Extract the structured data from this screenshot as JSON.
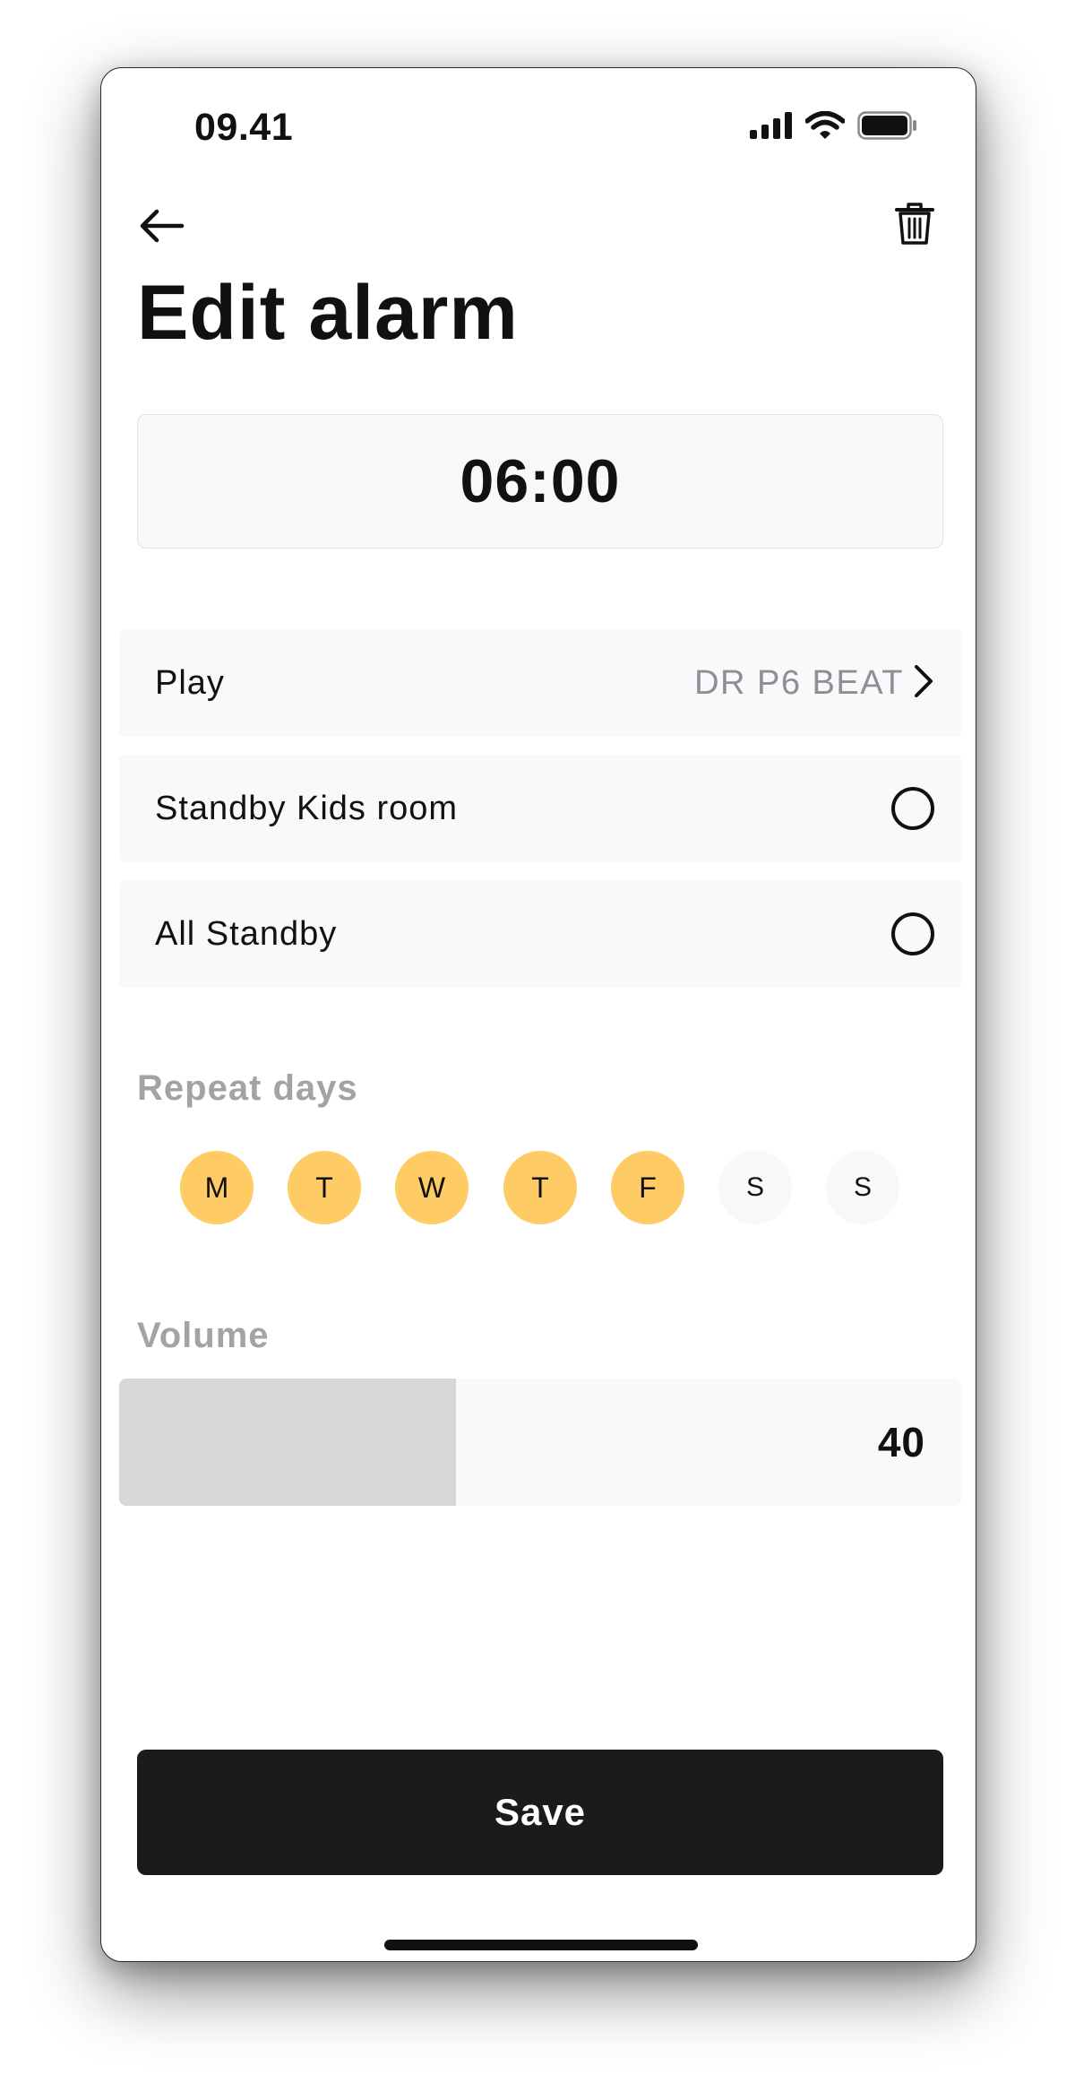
{
  "status_bar": {
    "time": "09.41",
    "icons": [
      "cellular-signal-icon",
      "wifi-icon",
      "battery-icon"
    ]
  },
  "header": {
    "back_icon": "arrow-left-icon",
    "delete_icon": "trash-icon",
    "title": "Edit alarm"
  },
  "alarm": {
    "time": "06:00"
  },
  "rows": {
    "play": {
      "label": "Play",
      "value": "DR P6 BEAT",
      "icon": "chevron-right-icon"
    },
    "standby_kids": {
      "label": "Standby Kids room",
      "selected": false
    },
    "all_standby": {
      "label": "All Standby",
      "selected": false
    }
  },
  "repeat": {
    "label": "Repeat days",
    "days": [
      {
        "letter": "M",
        "active": true
      },
      {
        "letter": "T",
        "active": true
      },
      {
        "letter": "W",
        "active": true
      },
      {
        "letter": "T",
        "active": true
      },
      {
        "letter": "F",
        "active": true
      },
      {
        "letter": "S",
        "active": false
      },
      {
        "letter": "S",
        "active": false
      }
    ]
  },
  "volume": {
    "label": "Volume",
    "value": "40",
    "level_fraction": 0.4
  },
  "actions": {
    "save_label": "Save"
  },
  "colors": {
    "accent_day": "#fecb64",
    "button_dark": "#1b1a1c",
    "muted_text": "#a2a2a7"
  }
}
